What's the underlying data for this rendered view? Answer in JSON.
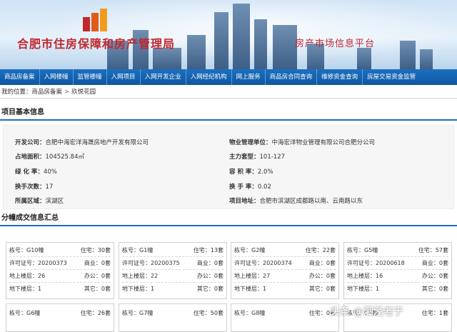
{
  "banner": {
    "title": "合肥市住房保障和房产管理局",
    "subtitle": "房产市场信息平台"
  },
  "nav": {
    "items": [
      "商品房备案",
      "入网楼幢",
      "监管楼幢",
      "入网项目",
      "入网开发企业",
      "入网经纪机构",
      "网上服务",
      "商品房合同查询",
      "维修资金查询",
      "房屋交易资金监管"
    ]
  },
  "breadcrumb": {
    "prefix": "我的位置：",
    "path": [
      "商品房备案",
      "玖悦花园"
    ]
  },
  "project": {
    "section_title": "项目基本信息",
    "left": [
      {
        "label": "开发公司：",
        "value": "合肥中海宏洋海晟房地产开发有限公司"
      },
      {
        "label": "占地面积：",
        "value": "104525.84㎡"
      },
      {
        "label": "绿 化 率：",
        "value": "40%"
      },
      {
        "label": "换手次数：",
        "value": "17"
      },
      {
        "label": "所属区域：",
        "value": "滨湖区"
      }
    ],
    "right": [
      {
        "label": "物业管理单位：",
        "value": "中海宏洋物业管理有限公司合肥分公司"
      },
      {
        "label": "主力套型：",
        "value": "101-127"
      },
      {
        "label": "容 积 率：",
        "value": "2.0%"
      },
      {
        "label": "换 手 率：",
        "value": "0.02"
      },
      {
        "label": "项目地址：",
        "value": "合肥市滨湖区成都路以南、云南路以东"
      }
    ]
  },
  "buildings": {
    "section_title": "分幢成交信息汇总",
    "cards": [
      {
        "name": "栋号：G10幢",
        "zhuzhai": "住宅：30套",
        "permit": "许可证号：20200373",
        "shangye": "商业：0套",
        "floors_up": "地上楼层：26",
        "bangong": "办公：0套",
        "floors_down": "地下楼层：1",
        "qita": "其它：0套"
      },
      {
        "name": "栋号：G1幢",
        "zhuzhai": "住宅：13套",
        "permit": "许可证号：20200375",
        "shangye": "商业：0套",
        "floors_up": "地上楼层：22",
        "bangong": "办公：0套",
        "floors_down": "地下楼层：1",
        "qita": "其它：0套"
      },
      {
        "name": "栋号：G2幢",
        "zhuzhai": "住宅：22套",
        "permit": "许可证号：20200374",
        "shangye": "商业：0套",
        "floors_up": "地上楼层：27",
        "bangong": "办公：0套",
        "floors_down": "地下楼层：1",
        "qita": "其它：0套"
      },
      {
        "name": "栋号：G5幢",
        "zhuzhai": "住宅：57套",
        "permit": "许可证号：20200618",
        "shangye": "商业：0套",
        "floors_up": "地上楼层：16",
        "bangong": "办公：0套",
        "floors_down": "地下楼层：1",
        "qita": "其它：0套"
      }
    ],
    "cards_row2": [
      {
        "name": "栋号：G6幢",
        "zhuzhai": "住宅：26套"
      },
      {
        "name": "栋号：G7幢",
        "zhuzhai": "住宅：50套"
      },
      {
        "name": "栋号：G8幢",
        "zhuzhai": "住宅：0套"
      },
      {
        "name": "栋号：G3幢",
        "zhuzhai": "住宅：1套"
      }
    ]
  },
  "watermark": "头条 @泗泾老于",
  "colors": {
    "nav_bg": "#1b70c0",
    "title_red": "#c1272d"
  }
}
